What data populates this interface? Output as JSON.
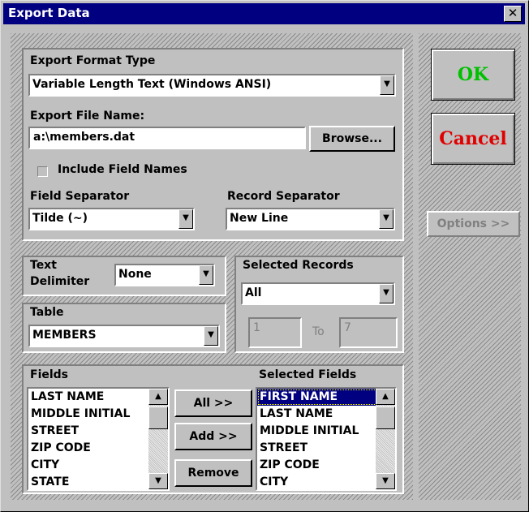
{
  "window": {
    "title": "Export Data",
    "close_glyph": "✕"
  },
  "export_format": {
    "label": "Export Format Type",
    "value": "Variable Length Text (Windows ANSI)"
  },
  "file_name": {
    "label": "Export File Name:",
    "value": "a:\\members.dat",
    "browse_label": "Browse..."
  },
  "include_field_names": {
    "label": "Include Field Names",
    "checked": false
  },
  "field_separator": {
    "label": "Field Separator",
    "value": "Tilde (~)"
  },
  "record_separator": {
    "label": "Record Separator",
    "value": "New Line"
  },
  "text_delimiter": {
    "label_line1": "Text",
    "label_line2": "Delimiter",
    "value": "None"
  },
  "table": {
    "label": "Table",
    "value": "MEMBERS"
  },
  "selected_records": {
    "label": "Selected Records",
    "value": "All",
    "from": "1",
    "to_label": "To",
    "to": "7"
  },
  "fields": {
    "label": "Fields",
    "items": [
      "LAST NAME",
      "MIDDLE INITIAL",
      "STREET",
      "ZIP CODE",
      "CITY",
      "STATE"
    ]
  },
  "selected_fields": {
    "label": "Selected Fields",
    "items": [
      "FIRST NAME",
      "LAST NAME",
      "MIDDLE INITIAL",
      "STREET",
      "ZIP CODE",
      "CITY"
    ],
    "selected_index": 0
  },
  "buttons": {
    "all": "All >>",
    "add": "Add >>",
    "remove": "Remove",
    "ok": "OK",
    "cancel": "Cancel",
    "options": "Options >>"
  },
  "colors": {
    "ok": "#00c000",
    "cancel": "#e00000",
    "title_bar": "#000080"
  }
}
